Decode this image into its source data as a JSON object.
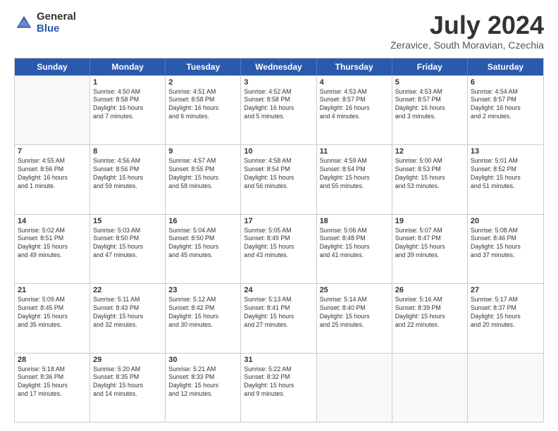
{
  "header": {
    "logo_general": "General",
    "logo_blue": "Blue",
    "month_title": "July 2024",
    "location": "Zeravice, South Moravian, Czechia"
  },
  "weekdays": [
    "Sunday",
    "Monday",
    "Tuesday",
    "Wednesday",
    "Thursday",
    "Friday",
    "Saturday"
  ],
  "weeks": [
    [
      {
        "day": "",
        "info": ""
      },
      {
        "day": "1",
        "info": "Sunrise: 4:50 AM\nSunset: 8:58 PM\nDaylight: 16 hours\nand 7 minutes."
      },
      {
        "day": "2",
        "info": "Sunrise: 4:51 AM\nSunset: 8:58 PM\nDaylight: 16 hours\nand 6 minutes."
      },
      {
        "day": "3",
        "info": "Sunrise: 4:52 AM\nSunset: 8:58 PM\nDaylight: 16 hours\nand 5 minutes."
      },
      {
        "day": "4",
        "info": "Sunrise: 4:53 AM\nSunset: 8:57 PM\nDaylight: 16 hours\nand 4 minutes."
      },
      {
        "day": "5",
        "info": "Sunrise: 4:53 AM\nSunset: 8:57 PM\nDaylight: 16 hours\nand 3 minutes."
      },
      {
        "day": "6",
        "info": "Sunrise: 4:54 AM\nSunset: 8:57 PM\nDaylight: 16 hours\nand 2 minutes."
      }
    ],
    [
      {
        "day": "7",
        "info": "Sunrise: 4:55 AM\nSunset: 8:56 PM\nDaylight: 16 hours\nand 1 minute."
      },
      {
        "day": "8",
        "info": "Sunrise: 4:56 AM\nSunset: 8:56 PM\nDaylight: 15 hours\nand 59 minutes."
      },
      {
        "day": "9",
        "info": "Sunrise: 4:57 AM\nSunset: 8:55 PM\nDaylight: 15 hours\nand 58 minutes."
      },
      {
        "day": "10",
        "info": "Sunrise: 4:58 AM\nSunset: 8:54 PM\nDaylight: 15 hours\nand 56 minutes."
      },
      {
        "day": "11",
        "info": "Sunrise: 4:59 AM\nSunset: 8:54 PM\nDaylight: 15 hours\nand 55 minutes."
      },
      {
        "day": "12",
        "info": "Sunrise: 5:00 AM\nSunset: 8:53 PM\nDaylight: 15 hours\nand 53 minutes."
      },
      {
        "day": "13",
        "info": "Sunrise: 5:01 AM\nSunset: 8:52 PM\nDaylight: 15 hours\nand 51 minutes."
      }
    ],
    [
      {
        "day": "14",
        "info": "Sunrise: 5:02 AM\nSunset: 8:51 PM\nDaylight: 15 hours\nand 49 minutes."
      },
      {
        "day": "15",
        "info": "Sunrise: 5:03 AM\nSunset: 8:50 PM\nDaylight: 15 hours\nand 47 minutes."
      },
      {
        "day": "16",
        "info": "Sunrise: 5:04 AM\nSunset: 8:50 PM\nDaylight: 15 hours\nand 45 minutes."
      },
      {
        "day": "17",
        "info": "Sunrise: 5:05 AM\nSunset: 8:49 PM\nDaylight: 15 hours\nand 43 minutes."
      },
      {
        "day": "18",
        "info": "Sunrise: 5:06 AM\nSunset: 8:48 PM\nDaylight: 15 hours\nand 41 minutes."
      },
      {
        "day": "19",
        "info": "Sunrise: 5:07 AM\nSunset: 8:47 PM\nDaylight: 15 hours\nand 39 minutes."
      },
      {
        "day": "20",
        "info": "Sunrise: 5:08 AM\nSunset: 8:46 PM\nDaylight: 15 hours\nand 37 minutes."
      }
    ],
    [
      {
        "day": "21",
        "info": "Sunrise: 5:09 AM\nSunset: 8:45 PM\nDaylight: 15 hours\nand 35 minutes."
      },
      {
        "day": "22",
        "info": "Sunrise: 5:11 AM\nSunset: 8:43 PM\nDaylight: 15 hours\nand 32 minutes."
      },
      {
        "day": "23",
        "info": "Sunrise: 5:12 AM\nSunset: 8:42 PM\nDaylight: 15 hours\nand 30 minutes."
      },
      {
        "day": "24",
        "info": "Sunrise: 5:13 AM\nSunset: 8:41 PM\nDaylight: 15 hours\nand 27 minutes."
      },
      {
        "day": "25",
        "info": "Sunrise: 5:14 AM\nSunset: 8:40 PM\nDaylight: 15 hours\nand 25 minutes."
      },
      {
        "day": "26",
        "info": "Sunrise: 5:16 AM\nSunset: 8:39 PM\nDaylight: 15 hours\nand 22 minutes."
      },
      {
        "day": "27",
        "info": "Sunrise: 5:17 AM\nSunset: 8:37 PM\nDaylight: 15 hours\nand 20 minutes."
      }
    ],
    [
      {
        "day": "28",
        "info": "Sunrise: 5:18 AM\nSunset: 8:36 PM\nDaylight: 15 hours\nand 17 minutes."
      },
      {
        "day": "29",
        "info": "Sunrise: 5:20 AM\nSunset: 8:35 PM\nDaylight: 15 hours\nand 14 minutes."
      },
      {
        "day": "30",
        "info": "Sunrise: 5:21 AM\nSunset: 8:33 PM\nDaylight: 15 hours\nand 12 minutes."
      },
      {
        "day": "31",
        "info": "Sunrise: 5:22 AM\nSunset: 8:32 PM\nDaylight: 15 hours\nand 9 minutes."
      },
      {
        "day": "",
        "info": ""
      },
      {
        "day": "",
        "info": ""
      },
      {
        "day": "",
        "info": ""
      }
    ]
  ]
}
